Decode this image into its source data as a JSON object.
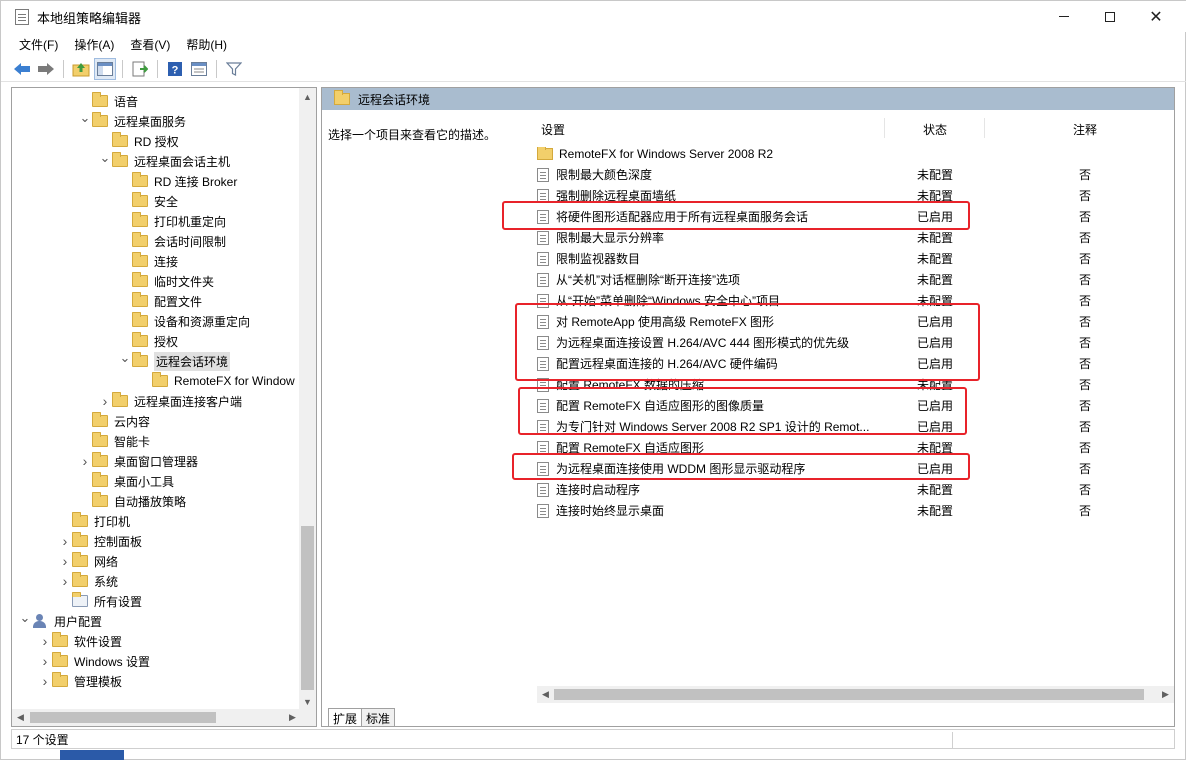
{
  "window": {
    "title": "本地组策略编辑器"
  },
  "menu": {
    "items": [
      "文件(F)",
      "操作(A)",
      "查看(V)",
      "帮助(H)"
    ]
  },
  "toolbar": {
    "icons": [
      "back-arrow-icon",
      "forward-arrow-icon",
      "up-folder-icon",
      "show-hide-tree-icon",
      "export-list-icon",
      "help-icon",
      "properties-icon",
      "filter-icon"
    ]
  },
  "tree": {
    "items": [
      {
        "label": "语音",
        "level": 4,
        "arrow": ""
      },
      {
        "label": "远程桌面服务",
        "level": 4,
        "arrow": "open"
      },
      {
        "label": "RD 授权",
        "level": 5,
        "arrow": ""
      },
      {
        "label": "远程桌面会话主机",
        "level": 5,
        "arrow": "open"
      },
      {
        "label": "RD 连接 Broker",
        "level": 6,
        "arrow": ""
      },
      {
        "label": "安全",
        "level": 6,
        "arrow": ""
      },
      {
        "label": "打印机重定向",
        "level": 6,
        "arrow": ""
      },
      {
        "label": "会话时间限制",
        "level": 6,
        "arrow": ""
      },
      {
        "label": "连接",
        "level": 6,
        "arrow": ""
      },
      {
        "label": "临时文件夹",
        "level": 6,
        "arrow": ""
      },
      {
        "label": "配置文件",
        "level": 6,
        "arrow": ""
      },
      {
        "label": "设备和资源重定向",
        "level": 6,
        "arrow": ""
      },
      {
        "label": "授权",
        "level": 6,
        "arrow": ""
      },
      {
        "label": "远程会话环境",
        "level": 6,
        "arrow": "open",
        "selected": true
      },
      {
        "label": "RemoteFX for Window",
        "level": 7,
        "arrow": ""
      },
      {
        "label": "远程桌面连接客户端",
        "level": 5,
        "arrow": "closed"
      },
      {
        "label": "云内容",
        "level": 4,
        "arrow": ""
      },
      {
        "label": "智能卡",
        "level": 4,
        "arrow": ""
      },
      {
        "label": "桌面窗口管理器",
        "level": 4,
        "arrow": "closed"
      },
      {
        "label": "桌面小工具",
        "level": 4,
        "arrow": ""
      },
      {
        "label": "自动播放策略",
        "level": 4,
        "arrow": ""
      },
      {
        "label": "打印机",
        "level": 3,
        "arrow": ""
      },
      {
        "label": "控制面板",
        "level": 3,
        "arrow": "closed"
      },
      {
        "label": "网络",
        "level": 3,
        "arrow": "closed"
      },
      {
        "label": "系统",
        "level": 3,
        "arrow": "closed"
      },
      {
        "label": "所有设置",
        "level": 3,
        "arrow": "",
        "icon": "all-settings"
      },
      {
        "label": "用户配置",
        "level": 1,
        "arrow": "open",
        "icon": "user"
      },
      {
        "label": "软件设置",
        "level": 2,
        "arrow": "closed"
      },
      {
        "label": "Windows 设置",
        "level": 2,
        "arrow": "closed"
      },
      {
        "label": "管理模板",
        "level": 2,
        "arrow": "closed"
      }
    ]
  },
  "right": {
    "header": "远程会话环境",
    "description": "选择一个项目来查看它的描述。",
    "columns": {
      "setting": "设置",
      "state": "状态",
      "note": "注释"
    },
    "rows": [
      {
        "name": "RemoteFX for Windows Server 2008 R2",
        "state": "",
        "note": "",
        "type": "folder"
      },
      {
        "name": "限制最大颜色深度",
        "state": "未配置",
        "note": "否"
      },
      {
        "name": "强制删除远程桌面墙纸",
        "state": "未配置",
        "note": "否"
      },
      {
        "name": "将硬件图形适配器应用于所有远程桌面服务会话",
        "state": "已启用",
        "note": "否"
      },
      {
        "name": "限制最大显示分辨率",
        "state": "未配置",
        "note": "否"
      },
      {
        "name": "限制监视器数目",
        "state": "未配置",
        "note": "否"
      },
      {
        "name": "从“关机”对话框删除“断开连接”选项",
        "state": "未配置",
        "note": "否"
      },
      {
        "name": "从“开始”菜单删除“Windows 安全中心”项目",
        "state": "未配置",
        "note": "否"
      },
      {
        "name": "对 RemoteApp 使用高级 RemoteFX 图形",
        "state": "已启用",
        "note": "否"
      },
      {
        "name": "为远程桌面连接设置 H.264/AVC 444 图形模式的优先级",
        "state": "已启用",
        "note": "否"
      },
      {
        "name": "配置远程桌面连接的 H.264/AVC 硬件编码",
        "state": "已启用",
        "note": "否"
      },
      {
        "name": "配置 RemoteFX 数据的压缩",
        "state": "未配置",
        "note": "否"
      },
      {
        "name": "配置 RemoteFX 自适应图形的图像质量",
        "state": "已启用",
        "note": "否"
      },
      {
        "name": "为专门针对 Windows Server 2008 R2 SP1 设计的 Remot...",
        "state": "已启用",
        "note": "否"
      },
      {
        "name": "配置 RemoteFX 自适应图形",
        "state": "未配置",
        "note": "否"
      },
      {
        "name": "为远程桌面连接使用 WDDM 图形显示驱动程序",
        "state": "已启用",
        "note": "否"
      },
      {
        "name": "连接时启动程序",
        "state": "未配置",
        "note": "否"
      },
      {
        "name": "连接时始终显示桌面",
        "state": "未配置",
        "note": "否"
      }
    ],
    "tabs": [
      "扩展",
      "标准"
    ]
  },
  "status": {
    "text": "17 个设置"
  },
  "colors": {
    "header_bar": "#a9bccf",
    "highlight": "#e8232a",
    "folder": "#f2cf6b"
  }
}
